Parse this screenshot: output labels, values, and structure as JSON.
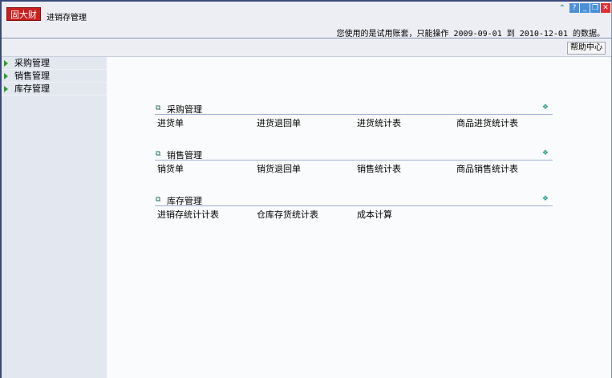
{
  "header": {
    "logo": "固大财",
    "app_title": "进销存管理",
    "notice": "您使用的是试用账套，只能操作 2009-09-01 到 2010-12-01 的数据。"
  },
  "window_buttons": {
    "collapse": "≈",
    "help": "?",
    "minimize": "_",
    "restore": "❐",
    "close": "✕"
  },
  "toolbar": {
    "help_center": "帮助中心"
  },
  "sidebar": {
    "items": [
      {
        "label": "采购管理"
      },
      {
        "label": "销售管理"
      },
      {
        "label": "库存管理"
      }
    ]
  },
  "sections": [
    {
      "title": "采购管理",
      "links": [
        "进货单",
        "进货退回单",
        "进货统计表",
        "商品进货统计表"
      ]
    },
    {
      "title": "销售管理",
      "links": [
        "销货单",
        "销货退回单",
        "销售统计表",
        "商品销售统计表"
      ]
    },
    {
      "title": "库存管理",
      "links": [
        "进销存统计计表",
        "仓库存货统计表",
        "成本计算"
      ]
    }
  ]
}
